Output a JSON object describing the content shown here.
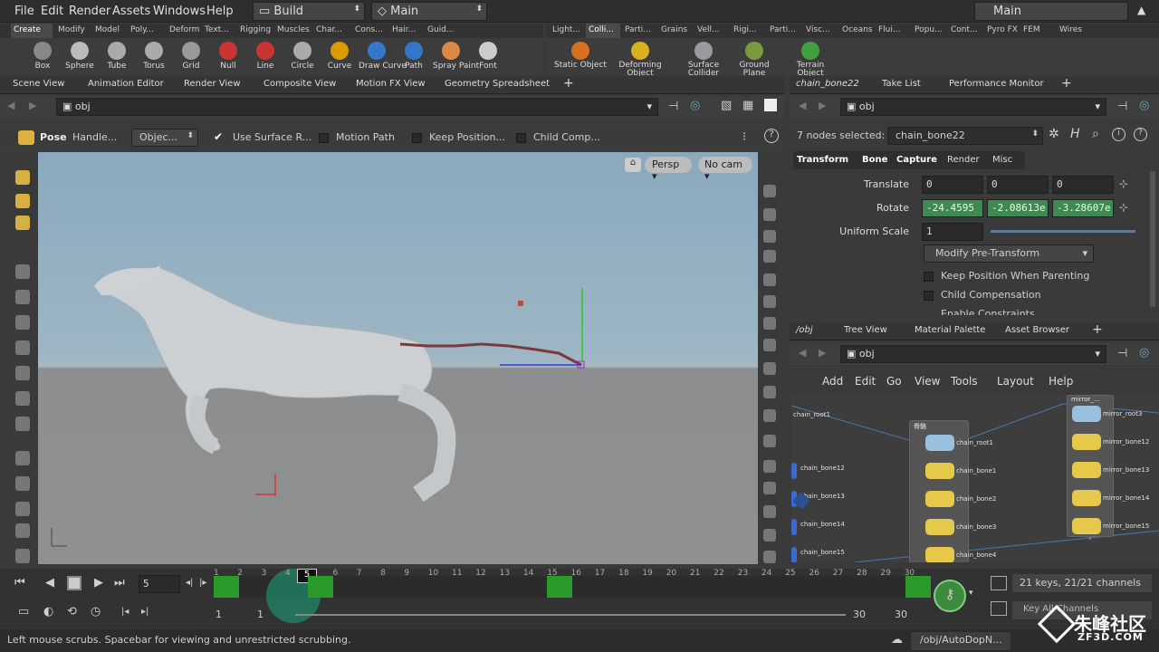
{
  "menu": {
    "file": "File",
    "edit": "Edit",
    "render": "Render",
    "assets": "Assets",
    "windows": "Windows",
    "help": "Help"
  },
  "desktop": {
    "build": "Build",
    "main": "Main",
    "main_right": "Main"
  },
  "shelf_tabs_left": [
    "Create",
    "Modify",
    "Model",
    "Poly...",
    "Deform",
    "Text...",
    "Rigging",
    "Muscles",
    "Char...",
    "Cons...",
    "Hair...",
    "Guid..."
  ],
  "shelf_tabs_right": [
    "Light...",
    "Colli...",
    "Parti...",
    "Grains",
    "Vell...",
    "Rigi...",
    "Parti...",
    "Visc...",
    "Oceans",
    "Flui...",
    "Popu...",
    "Cont...",
    "Pyro FX",
    "FEM",
    "Wires"
  ],
  "tools_left": [
    "Box",
    "Sphere",
    "Tube",
    "Torus",
    "Grid",
    "Null",
    "Line",
    "Circle",
    "Curve",
    "Draw Curve",
    "Path",
    "Spray Paint",
    "Font"
  ],
  "tools_right": [
    "Static Object",
    "Deforming Object",
    "Surface Collider",
    "Ground Plane",
    "Terrain Object"
  ],
  "pane_tabs_left": [
    "Scene View",
    "Animation Editor",
    "Render View",
    "Composite View",
    "Motion FX View",
    "Geometry Spreadsheet"
  ],
  "pane_tabs_right": [
    "chain_bone22",
    "Take List",
    "Performance Monitor"
  ],
  "path_left": "obj",
  "path_right": "obj",
  "pose": {
    "title": "Pose",
    "handle": "Handle...",
    "object": "Objec...",
    "use_surface": "Use Surface R...",
    "motion_path": "Motion Path",
    "keep_position": "Keep Position...",
    "child_comp": "Child Comp..."
  },
  "viewport": {
    "persp": "Persp",
    "cam": "No cam"
  },
  "params": {
    "selected": "7 nodes selected:",
    "node": "chain_bone22",
    "tabs": [
      "Transform",
      "Bone",
      "Capture",
      "Render",
      "Misc"
    ],
    "translate_label": "Translate",
    "translate": [
      "0",
      "0",
      "0"
    ],
    "rotate_label": "Rotate",
    "rotate": [
      "-24.4595",
      "-2.08613e",
      "-3.28607e"
    ],
    "scale_label": "Uniform Scale",
    "scale": "1",
    "modify": "Modify Pre-Transform",
    "keep_pos": "Keep Position When Parenting",
    "child_comp": "Child Compensation",
    "enable_constraints": "Enable Constraints"
  },
  "net_tabs": [
    "/obj",
    "Tree View",
    "Material Palette",
    "Asset Browser"
  ],
  "net_path": "obj",
  "net_menu": [
    "Add",
    "Edit",
    "Go",
    "View",
    "Tools",
    "Layout",
    "Help"
  ],
  "net_nodes_left": [
    "chain_root1",
    "chain_bone12",
    "chain_bone13",
    "chain_bone14",
    "chain_bone15"
  ],
  "net_group_title": "骨骼",
  "net_nodes_mid": [
    "chain_root1",
    "chain_bone1",
    "chain_bone2",
    "chain_bone3",
    "chain_bone4"
  ],
  "net_group2_title": "mirror_...",
  "net_nodes_right": [
    "mirror_root3",
    "mirror_bone12",
    "mirror_bone13",
    "mirror_bone14",
    "mirror_bone15"
  ],
  "timeline": {
    "frame": "5",
    "current_marker": "5",
    "ticks": [
      "1",
      "2",
      "3",
      "4",
      "6",
      "7",
      "8",
      "9",
      "10",
      "11",
      "12",
      "13",
      "14",
      "15",
      "16",
      "17",
      "18",
      "19",
      "20",
      "21",
      "22",
      "23",
      "24",
      "25",
      "26",
      "27",
      "28",
      "29",
      "30"
    ],
    "start": "1",
    "start2": "1",
    "end": "30",
    "end2": "30",
    "keys_info": "21 keys, 21/21 channels",
    "key_all": "Key All Channels"
  },
  "status": {
    "text": "Left mouse scrubs. Spacebar for viewing and unrestricted scrubbing.",
    "path": "/obj/AutoDopN..."
  },
  "watermark": "朱峰社区",
  "watermark_sub": "ZF3D.COM"
}
